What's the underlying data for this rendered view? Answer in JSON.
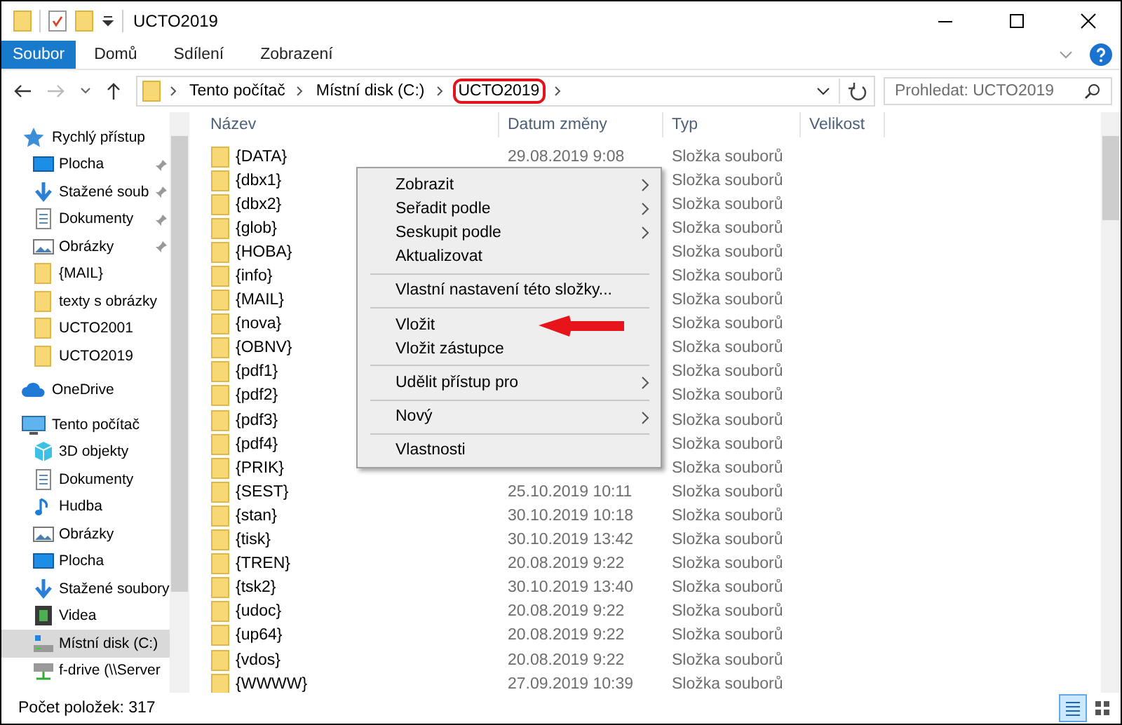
{
  "window": {
    "title": "UCTO2019"
  },
  "ribbon_tabs": [
    {
      "label": "Soubor",
      "selected": true
    },
    {
      "label": "Domů",
      "selected": false
    },
    {
      "label": "Sdílení",
      "selected": false
    },
    {
      "label": "Zobrazení",
      "selected": false
    }
  ],
  "address": {
    "crumbs": [
      {
        "label": "Tento počítač",
        "highlighted": false
      },
      {
        "label": "Místní disk (C:)",
        "highlighted": false
      },
      {
        "label": "UCTO2019",
        "highlighted": true
      }
    ]
  },
  "search": {
    "placeholder": "Prohledat: UCTO2019"
  },
  "sidebar": {
    "items": [
      {
        "label": "Rychlý přístup",
        "kind": "star",
        "selected": false,
        "children": [
          {
            "label": "Plocha",
            "kind": "desktop",
            "pinned": true,
            "selected": false
          },
          {
            "label": "Stažené soub",
            "kind": "download",
            "pinned": true,
            "selected": false
          },
          {
            "label": "Dokumenty",
            "kind": "document",
            "pinned": true,
            "selected": false
          },
          {
            "label": "Obrázky",
            "kind": "pictures",
            "pinned": true,
            "selected": false
          },
          {
            "label": "{MAIL}",
            "kind": "folder",
            "pinned": false,
            "selected": false
          },
          {
            "label": "texty s obrázky",
            "kind": "folder",
            "pinned": false,
            "selected": false
          },
          {
            "label": "UCTO2001",
            "kind": "folder",
            "pinned": false,
            "selected": false
          },
          {
            "label": "UCTO2019",
            "kind": "folder",
            "pinned": false,
            "selected": false
          }
        ]
      },
      {
        "label": "OneDrive",
        "kind": "cloud",
        "selected": false
      },
      {
        "label": "Tento počítač",
        "kind": "computer",
        "selected": false,
        "children": [
          {
            "label": "3D objekty",
            "kind": "cube",
            "selected": false
          },
          {
            "label": "Dokumenty",
            "kind": "document",
            "selected": false
          },
          {
            "label": "Hudba",
            "kind": "music",
            "selected": false
          },
          {
            "label": "Obrázky",
            "kind": "pictures",
            "selected": false
          },
          {
            "label": "Plocha",
            "kind": "desktop",
            "selected": false
          },
          {
            "label": "Stažené soubory",
            "kind": "download",
            "selected": false
          },
          {
            "label": "Videa",
            "kind": "video",
            "selected": false
          },
          {
            "label": "Místní disk (C:)",
            "kind": "drive",
            "selected": true
          },
          {
            "label": "f-drive (\\\\Server",
            "kind": "netdrive",
            "selected": false
          }
        ]
      }
    ]
  },
  "table": {
    "columns": [
      "Název",
      "Datum změny",
      "Typ",
      "Velikost"
    ],
    "rows": [
      {
        "name": "{DATA}",
        "date": "29.08.2019 9:08",
        "type": "Složka souborů"
      },
      {
        "name": "{dbx1}",
        "type": "Složka souborů"
      },
      {
        "name": "{dbx2}",
        "type": "Složka souborů"
      },
      {
        "name": "{glob}",
        "type": "Složka souborů"
      },
      {
        "name": "{HOBA}",
        "type": "Složka souborů"
      },
      {
        "name": "{info}",
        "type": "Složka souborů"
      },
      {
        "name": "{MAIL}",
        "type": "Složka souborů"
      },
      {
        "name": "{nova}",
        "type": "Složka souborů"
      },
      {
        "name": "{OBNV}",
        "type": "Složka souborů"
      },
      {
        "name": "{pdf1}",
        "type": "Složka souborů"
      },
      {
        "name": "{pdf2}",
        "type": "Složka souborů"
      },
      {
        "name": "{pdf3}",
        "type": "Složka souborů"
      },
      {
        "name": "{pdf4}",
        "type": "Složka souborů"
      },
      {
        "name": "{PRIK}",
        "type": "Složka souborů"
      },
      {
        "name": "{SEST}",
        "date": "25.10.2019 10:11",
        "type": "Složka souborů"
      },
      {
        "name": "{stan}",
        "date": "30.10.2019 10:18",
        "type": "Složka souborů"
      },
      {
        "name": "{tisk}",
        "date": "30.10.2019 13:42",
        "type": "Složka souborů"
      },
      {
        "name": "{TREN}",
        "date": "20.08.2019 9:22",
        "type": "Složka souborů"
      },
      {
        "name": "{tsk2}",
        "date": "30.10.2019 13:40",
        "type": "Složka souborů"
      },
      {
        "name": "{udoc}",
        "date": "20.08.2019 9:22",
        "type": "Složka souborů"
      },
      {
        "name": "{up64}",
        "date": "20.08.2019 9:22",
        "type": "Složka souborů"
      },
      {
        "name": "{vdos}",
        "date": "20.08.2019 9:22",
        "type": "Složka souborů"
      },
      {
        "name": "{WWWW}",
        "date": "27.09.2019 10:39",
        "type": "Složka souborů"
      }
    ]
  },
  "context_menu": {
    "items": [
      {
        "kind": "item",
        "label": "Zobrazit",
        "submenu": true
      },
      {
        "kind": "item",
        "label": "Seřadit podle",
        "submenu": true
      },
      {
        "kind": "item",
        "label": "Seskupit podle",
        "submenu": true
      },
      {
        "kind": "item",
        "label": "Aktualizovat",
        "submenu": false
      },
      {
        "kind": "separator"
      },
      {
        "kind": "item",
        "label": "Vlastní nastavení této složky...",
        "submenu": false
      },
      {
        "kind": "separator"
      },
      {
        "kind": "item",
        "label": "Vložit",
        "submenu": false,
        "pointed": true
      },
      {
        "kind": "item",
        "label": "Vložit zástupce",
        "submenu": false
      },
      {
        "kind": "separator"
      },
      {
        "kind": "item",
        "label": "Udělit přístup pro",
        "submenu": true
      },
      {
        "kind": "separator"
      },
      {
        "kind": "item",
        "label": "Nový",
        "submenu": true
      },
      {
        "kind": "separator"
      },
      {
        "kind": "item",
        "label": "Vlastnosti",
        "submenu": false
      }
    ]
  },
  "status_bar": {
    "text": "Počet položek: 317"
  }
}
